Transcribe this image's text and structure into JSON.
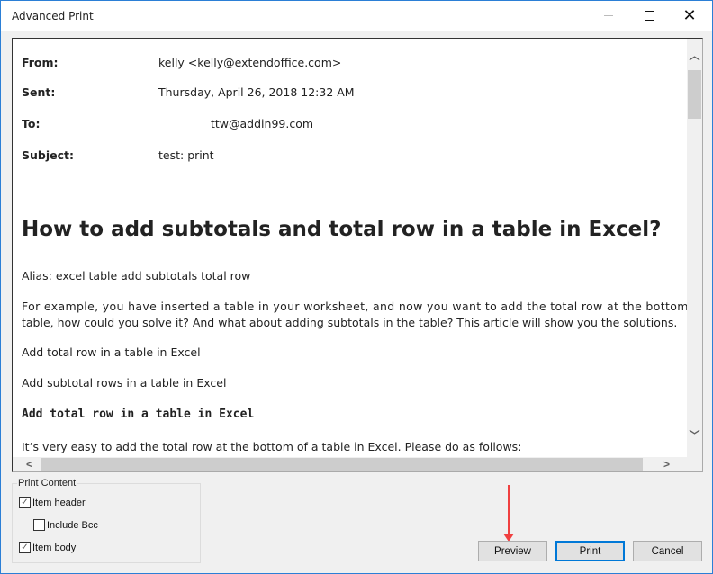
{
  "window": {
    "title": "Advanced Print"
  },
  "email": {
    "header": [
      {
        "label": "From:",
        "value": "kelly <kelly@extendoffice.com>"
      },
      {
        "label": "Sent:",
        "value": "Thursday, April 26, 2018 12:32 AM"
      },
      {
        "label": "To:",
        "value": "ttw@addin99.com"
      },
      {
        "label": "Subject:",
        "value": "test: print"
      }
    ],
    "body": {
      "heading": "How to add subtotals and total row in a table in Excel?",
      "alias": "Alias: excel table add subtotals total row",
      "intro_line1": "For example, you have inserted a table in your worksheet, and now you want to add the total row at the bottom of the",
      "intro_line2": "table, how could you solve it? And what about adding subtotals in the table? This article will show you the solutions.",
      "link1": "Add total row in a table in Excel",
      "link2": "Add subtotal rows in a table in Excel",
      "section_heading": "Add total row in a table in Excel",
      "section_text": "It’s very easy to add the total row at the bottom of a table in Excel. Please do as follows:"
    }
  },
  "print_content": {
    "label": "Print Content",
    "item_header": {
      "label": "Item header",
      "checked": true
    },
    "include_bcc": {
      "label": "Include Bcc",
      "checked": false
    },
    "item_body": {
      "label": "Item body",
      "checked": true
    }
  },
  "buttons": {
    "preview": "Preview",
    "print": "Print",
    "cancel": "Cancel"
  },
  "colors": {
    "annotation_arrow": "#f04040",
    "default_button_border": "#0078d7"
  }
}
